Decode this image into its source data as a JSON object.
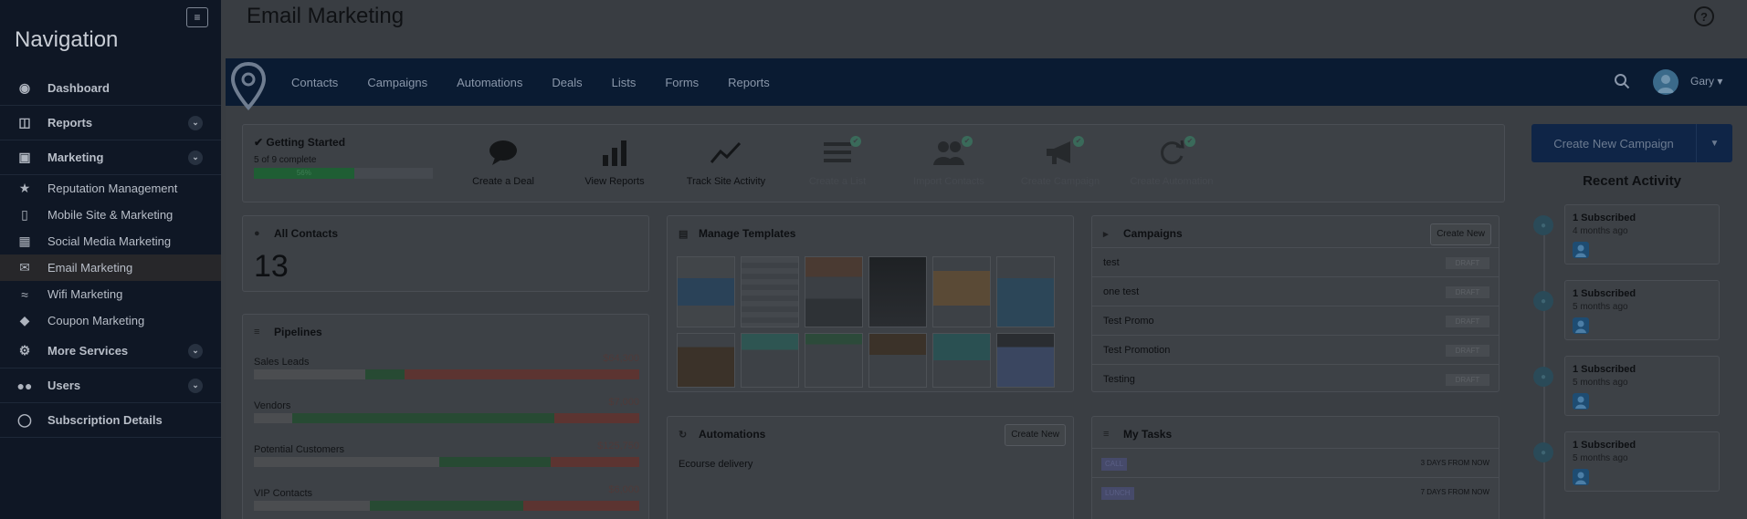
{
  "sidebar": {
    "title": "Navigation",
    "items": [
      {
        "label": "Dashboard",
        "icon": "dashboard-icon",
        "type": "main",
        "expandable": false
      },
      {
        "label": "Reports",
        "icon": "reports-icon",
        "type": "main",
        "expandable": true
      },
      {
        "label": "Marketing",
        "icon": "cart-icon",
        "type": "main",
        "expandable": true
      },
      {
        "label": "Reputation Management",
        "icon": "star-icon",
        "type": "sub"
      },
      {
        "label": "Mobile Site & Marketing",
        "icon": "mobile-icon",
        "type": "sub"
      },
      {
        "label": "Social Media Marketing",
        "icon": "chat-icon",
        "type": "sub"
      },
      {
        "label": "Email Marketing",
        "icon": "envelope-icon",
        "type": "sub",
        "active": true
      },
      {
        "label": "Wifi Marketing",
        "icon": "wifi-icon",
        "type": "sub"
      },
      {
        "label": "Coupon Marketing",
        "icon": "tag-icon",
        "type": "sub"
      },
      {
        "label": "More Services",
        "icon": "gear-icon",
        "type": "main",
        "expandable": true
      },
      {
        "label": "Users",
        "icon": "users-icon",
        "type": "main",
        "expandable": true
      },
      {
        "label": "Subscription Details",
        "icon": "lightbulb-icon",
        "type": "main",
        "expandable": false
      }
    ]
  },
  "header": {
    "title": "Email Marketing",
    "help_icon": "?"
  },
  "topnav": {
    "links": [
      "Contacts",
      "Campaigns",
      "Automations",
      "Deals",
      "Lists",
      "Forms",
      "Reports"
    ],
    "user": "Gary"
  },
  "getting_started": {
    "title": "Getting Started",
    "subtitle": "5 of 9 complete",
    "progress_label": "56%",
    "progress": 0.56,
    "steps": [
      {
        "label": "Create a Deal",
        "icon": "chat-bubble-icon",
        "done": false
      },
      {
        "label": "View Reports",
        "icon": "bar-chart-icon",
        "done": false
      },
      {
        "label": "Track Site Activity",
        "icon": "trend-line-icon",
        "done": false
      },
      {
        "label": "Create a List",
        "icon": "list-icon",
        "done": true
      },
      {
        "label": "Import Contacts",
        "icon": "users-icon",
        "done": true
      },
      {
        "label": "Create Campaign",
        "icon": "megaphone-icon",
        "done": true
      },
      {
        "label": "Create Automation",
        "icon": "refresh-icon",
        "done": true
      }
    ]
  },
  "contacts": {
    "title": "All Contacts",
    "count": "13"
  },
  "pipelines": {
    "title": "Pipelines",
    "rows": [
      {
        "label": "Sales Leads",
        "value": "$64,300",
        "segments": [
          0.29,
          0.1,
          0.61
        ]
      },
      {
        "label": "Vendors",
        "value": "$7,000",
        "segments": [
          0.1,
          0.68,
          0.22
        ]
      },
      {
        "label": "Potential Customers",
        "value": "$125,750",
        "segments": [
          0.48,
          0.29,
          0.23
        ]
      },
      {
        "label": "VIP Contacts",
        "value": "$6,000",
        "segments": [
          0.3,
          0.4,
          0.3
        ]
      }
    ],
    "colors": [
      "#4b4d50",
      "#274a33",
      "#5c3431"
    ]
  },
  "templates": {
    "title": "Manage Templates"
  },
  "automations": {
    "title": "Automations",
    "create_label": "Create New",
    "items": [
      "Ecourse delivery"
    ]
  },
  "campaigns": {
    "title": "Campaigns",
    "create_label": "Create New",
    "rows": [
      {
        "name": "test",
        "status": "DRAFT"
      },
      {
        "name": "one test",
        "status": "DRAFT"
      },
      {
        "name": "Test Promo",
        "status": "DRAFT"
      },
      {
        "name": "Test Promotion",
        "status": "DRAFT"
      },
      {
        "name": "Testing",
        "status": "DRAFT"
      }
    ]
  },
  "tasks": {
    "title": "My Tasks",
    "rows": [
      {
        "type": "CALL",
        "due": "3 DAYS FROM NOW"
      },
      {
        "type": "LUNCH",
        "due": "7 DAYS FROM NOW"
      }
    ]
  },
  "right": {
    "create_campaign": "Create New Campaign",
    "recent_title": "Recent Activity",
    "activities": [
      {
        "title": "1 Subscribed",
        "time": "4 months ago"
      },
      {
        "title": "1 Subscribed",
        "time": "5 months ago"
      },
      {
        "title": "1 Subscribed",
        "time": "5 months ago"
      },
      {
        "title": "1 Subscribed",
        "time": "5 months ago"
      }
    ]
  }
}
